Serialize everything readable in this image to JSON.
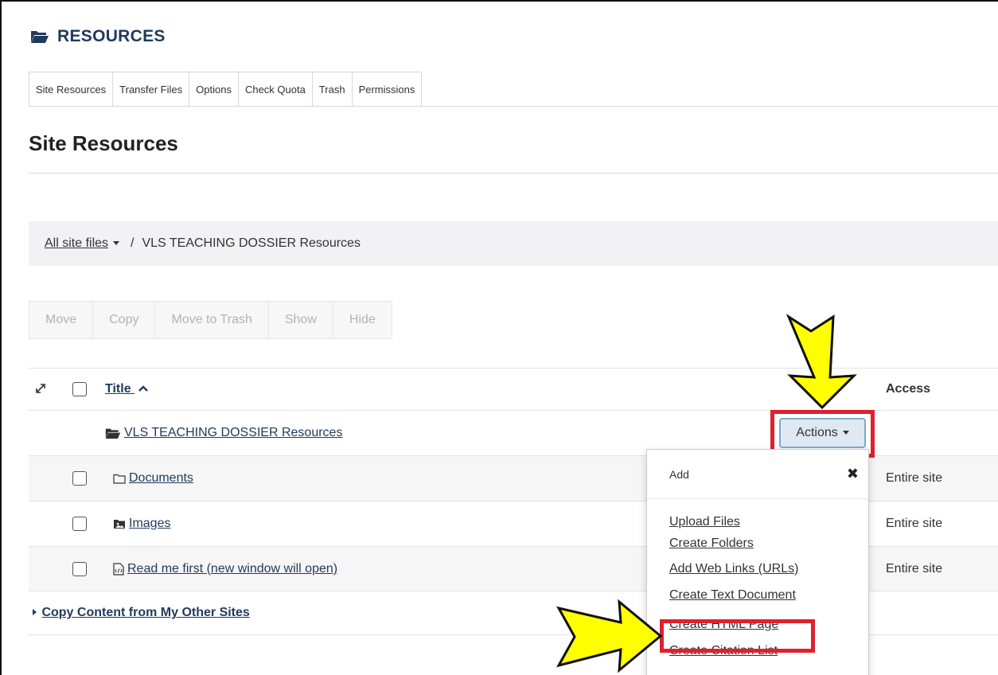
{
  "tool": {
    "title": "RESOURCES",
    "icon": "folder-open-icon"
  },
  "tabs": [
    {
      "label": "Site Resources",
      "active": true
    },
    {
      "label": "Transfer Files"
    },
    {
      "label": "Options"
    },
    {
      "label": "Check Quota"
    },
    {
      "label": "Trash"
    },
    {
      "label": "Permissions"
    }
  ],
  "page_title": "Site Resources",
  "breadcrumb": {
    "root": "All site files",
    "separator": "/",
    "current": "VLS TEACHING DOSSIER Resources"
  },
  "bulk_actions": [
    "Move",
    "Copy",
    "Move to Trash",
    "Show",
    "Hide"
  ],
  "table": {
    "headers": {
      "title": "Title",
      "sort_icon": "chevron-up-icon",
      "access": "Access"
    },
    "root_folder": {
      "name": "VLS TEACHING DOSSIER Resources",
      "icon": "folder-open-icon"
    },
    "actions_label": "Actions",
    "rows": [
      {
        "name": "Documents",
        "icon": "folder-outline-icon",
        "access": "Entire site"
      },
      {
        "name": "Images",
        "icon": "folder-image-icon",
        "access": "Entire site"
      },
      {
        "name": "Read me first (new window will open)",
        "icon": "html-file-icon",
        "access": "Entire site"
      }
    ],
    "copy_content": "Copy Content from My Other Sites"
  },
  "dropdown": {
    "header": "Add",
    "close_icon": "close-icon",
    "items": [
      "Upload Files",
      "Create Folders",
      "Add Web Links (URLs)",
      "Create Text Document",
      "Create HTML Page",
      "Create Citation List"
    ]
  },
  "colors": {
    "highlight_red": "#e0202e",
    "arrow_yellow": "#ffff00",
    "heading_blue": "#1f3a5c"
  }
}
